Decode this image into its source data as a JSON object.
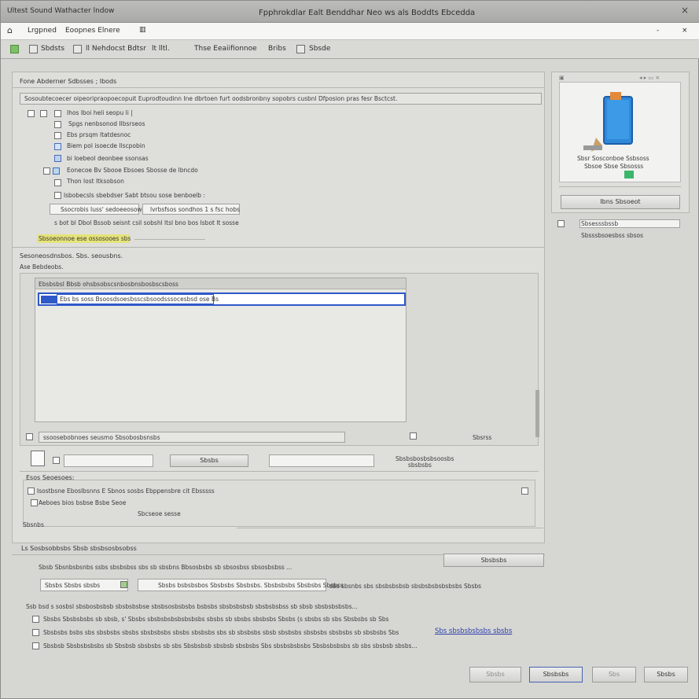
{
  "window": {
    "app_title": "Ultest Sound Wathacter lndow",
    "doc_title": "Fpphrokdlar Ealt Benddhar Neo ws als Boddts Ebcedda",
    "close": "×",
    "menu_close": "×",
    "menu_minimize": "-"
  },
  "menu": [
    "Lrgpned",
    "Eoopnes Elnere"
  ],
  "toolbar": {
    "items": [
      "Sbdsts",
      "ll Nehdocst Bdtsr",
      "lt lltl.",
      "Thse Eeaiifionnoe",
      "Bribs",
      "Sbsde"
    ]
  },
  "left_panel": {
    "title": "Fone Abderner Sdbsses ; Ibods",
    "path_row": "Sosoubtecoecer oipeoripraopoecopuit Euprodtoudinn Ine dbrtoen furt oodsbronbny sopobrs cusbnl Dfposion pras fesr Bsctcst.",
    "tree": [
      "Ihos lboi heli seopu li |",
      "Spgs nenbsonod Ilbsrseos",
      "Ebs prsqm ltatdesnoc",
      "Biem pol isoecde llscpobin",
      "bi loebeol deonbee ssonsas",
      "Eonecoe Bv Sbooe Ebsoes  Sbosse de lbncdo",
      "Thon lost ltksobson",
      "lsbobecsls sbebdser Sabt btsou sose benboelb :",
      "Ssocrobis Iuss' sedoeeosow",
      "lvrbsfsos sondhos 1 s fsc hobs",
      "s bot bl Dbol Bssob seisnt csil sobshl ltsl bno bos Isbot lt sosse"
    ],
    "highlight_text": "Sbsoeonnoe ese ossosooes sbs",
    "section_header": "Sesoneosdnsbos. Sbs. seousbns.",
    "section_sub": "Ase Bebdeobs.",
    "list_header": "Ebsbsbsl Bbsb ohsbsobscsnbosbnsbosbscsboss",
    "list_selected": "Ebs bs soss Bsoosdsoesbsscsbsoodsssocesbsd ose Bs",
    "list_footer": "ssoosebobnoes seusmo Sbsobosbsnsbs",
    "sort_label": "Sbsrss",
    "btn_row_label": "Sbsbs",
    "btn_row_right": "Sbsbsbosbsbsoosbs",
    "btn_row_right2": "sbsbsbs",
    "group_title": "Esos Seoesoes:",
    "group_items": [
      "Isostbsne Eboslbsnns E Sbnos sosbs Ebppensbre cit Ebsssss",
      "Aeboes bios bsbse Bsbe Seoe"
    ],
    "group_btn": "Sbcseoe sesse",
    "sbsnbe": "Sbsnbs"
  },
  "preview_panel": {
    "caption": "Sbsr Sosconboe Ssbsoss",
    "caption2": "Sbsoe Sbse Sbsosss",
    "button": "Ibns Sbsoeot",
    "field_text": "Sbsesssbssb",
    "field_text2": "Sbsssbsoesbss sbsos"
  },
  "bottom": {
    "section_label": "Ls Sosbsobbsbs Sbsb sbsbsosbsobss",
    "field_label": "Sbsb Sbsnbsbsnbs ssbs sbsbsbss  sbs sb sbsbns Bbsosbsbs sb sbsosbss sbsosbsbss ...",
    "browse_btn": "Sbsbsbs",
    "path_label": "Sbsbs Sbsbs sbsbs",
    "path_value": "Sbsbs bsbsbsbos Sbsbsbs Sbsbsbs. Sbsbsbsbs Sbsbsbs Sbsbss",
    "path_desc": "sbs sbsnbs sbs sbsbsbsbsb sbsbsbsbsbsbsbs Sbsbs",
    "option_header": "Ssb bsd s sosbsl sbsbosbsbsb sbsbsbsbse sbsbsosbsbsbs bsbsbs sbsbsbsbsb sbsbsbsbss sb sbsb sbsbsbsbsbs...",
    "options": [
      "Sbsbs Sbsbsbsbs sb sbsb, s' Sbsbs sbsbsbsbsbsbsbsbs sbsbs sb sbsbs sbsbsbs Sbsbs (s sbsbs sb sbs Sbsbsbs sb Sbs",
      "Sbsbsbs bsbs sbs sbsbsbs sbsbs sbsbsbsbs sbsbs sbsbsbs sbs sb sbsbsbs sbsb sbsbsbs sbsbsbs sbsbsbs sb sbsbsbs Sbs",
      "Sbsbsb Sbsbsbsbsbs sb Sbsbsb sbsbsbs sb sbs Sbsbsbsb sbsbsb sbsbsbs Sbs sbsbsbsbsbs Sbsbsbsbsbs sb sbs sbsbsb sbsbs..."
    ],
    "option_link": "Sbs sbsbsbsbsbs sbsbs",
    "buttons": [
      "Sbsbs",
      "Sbsbsbs",
      "Sbs",
      "Sbsbs"
    ]
  }
}
